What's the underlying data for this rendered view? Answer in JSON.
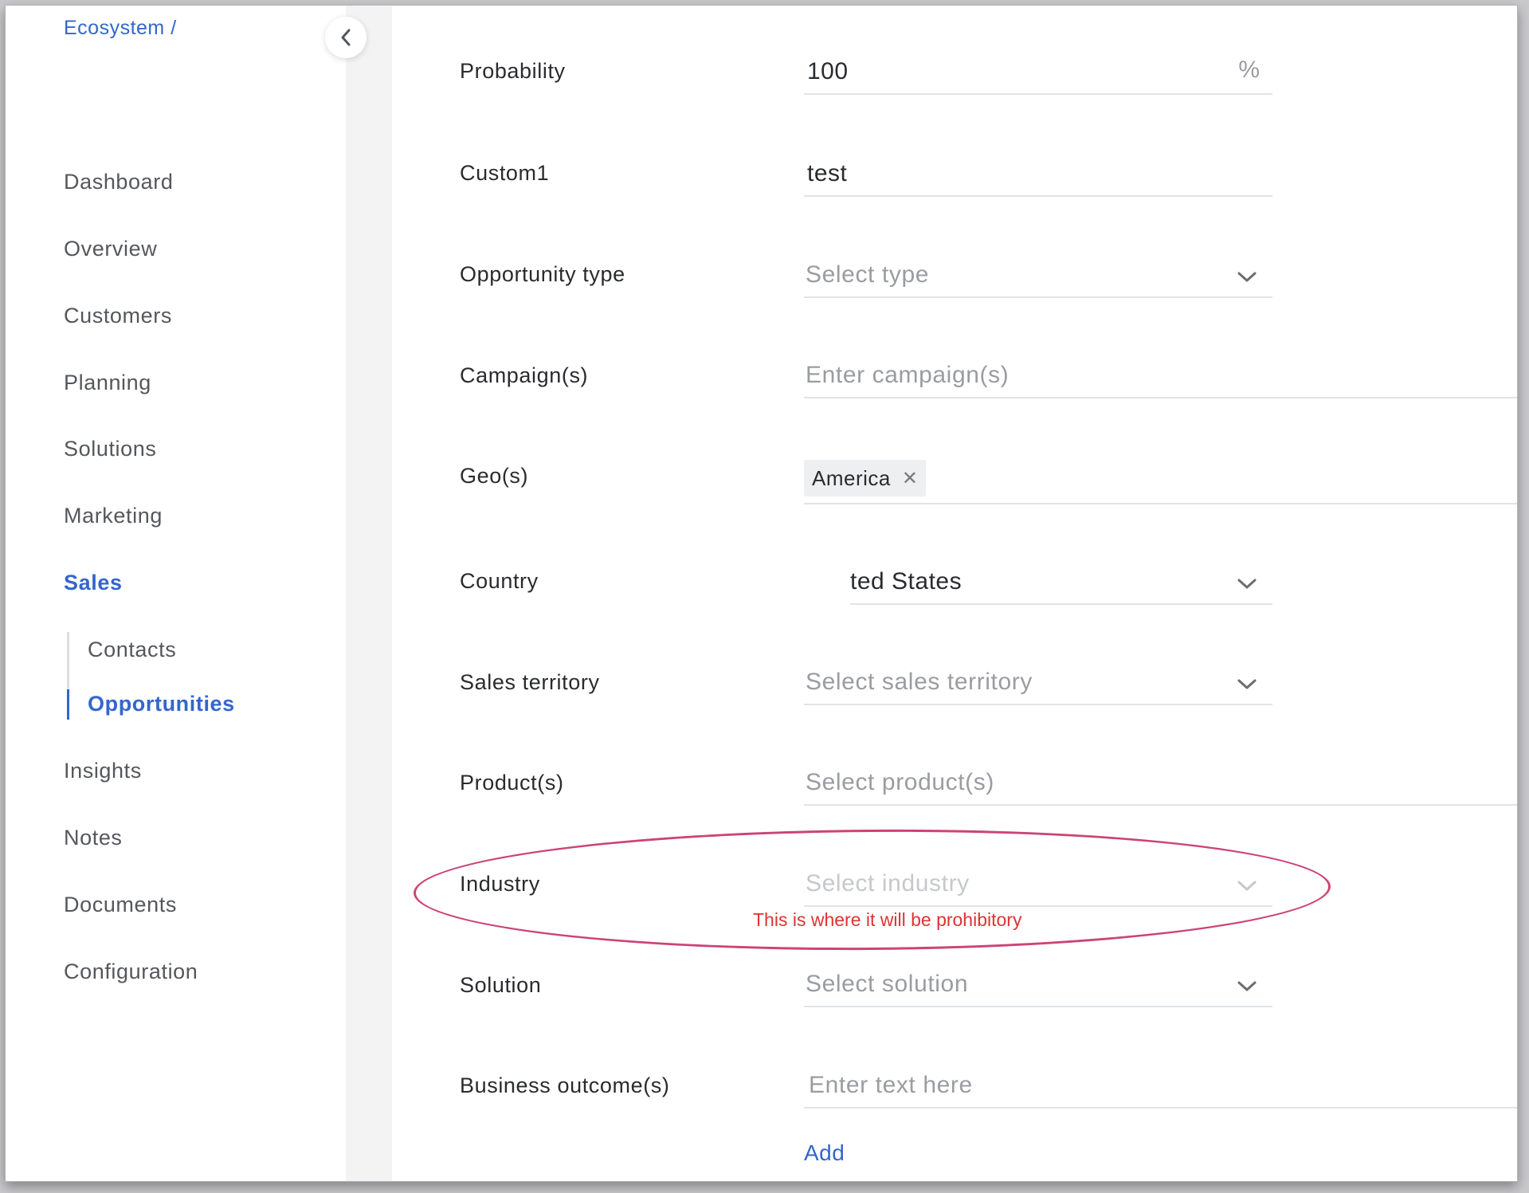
{
  "breadcrumb": "Ecosystem /",
  "sidebar": {
    "items": [
      {
        "label": "Dashboard"
      },
      {
        "label": "Overview"
      },
      {
        "label": "Customers"
      },
      {
        "label": "Planning"
      },
      {
        "label": "Solutions"
      },
      {
        "label": "Marketing"
      },
      {
        "label": "Sales",
        "active": true
      },
      {
        "label": "Insights"
      },
      {
        "label": "Notes"
      },
      {
        "label": "Documents"
      },
      {
        "label": "Configuration"
      }
    ],
    "sales_sub": [
      {
        "label": "Contacts"
      },
      {
        "label": "Opportunities",
        "active": true
      }
    ],
    "collapse_icon": "chevron-left-icon"
  },
  "form": {
    "probability": {
      "label": "Probability",
      "value": "100",
      "suffix": "%"
    },
    "custom1": {
      "label": "Custom1",
      "value": "test"
    },
    "opportunity_type": {
      "label": "Opportunity type",
      "placeholder": "Select type"
    },
    "campaigns": {
      "label": "Campaign(s)",
      "placeholder": "Enter campaign(s)"
    },
    "geos": {
      "label": "Geo(s)",
      "tags": [
        "America"
      ]
    },
    "country": {
      "label": "Country",
      "value": "ted States"
    },
    "sales_territory": {
      "label": "Sales territory",
      "placeholder": "Select sales territory"
    },
    "products": {
      "label": "Product(s)",
      "placeholder": "Select product(s)"
    },
    "industry": {
      "label": "Industry",
      "placeholder": "Select industry"
    },
    "solution": {
      "label": "Solution",
      "placeholder": "Select solution"
    },
    "business_outcomes": {
      "label": "Business outcome(s)",
      "placeholder": "Enter text here"
    },
    "add_label": "Add"
  },
  "annotation": {
    "text": "This is where it will be prohibitory",
    "color": "#cc4477",
    "text_color": "#dd3333"
  },
  "colors": {
    "accent": "#3366cc",
    "label": "#2a2b2e",
    "placeholder": "#9a9ca1",
    "underline": "#e2e3e6"
  }
}
